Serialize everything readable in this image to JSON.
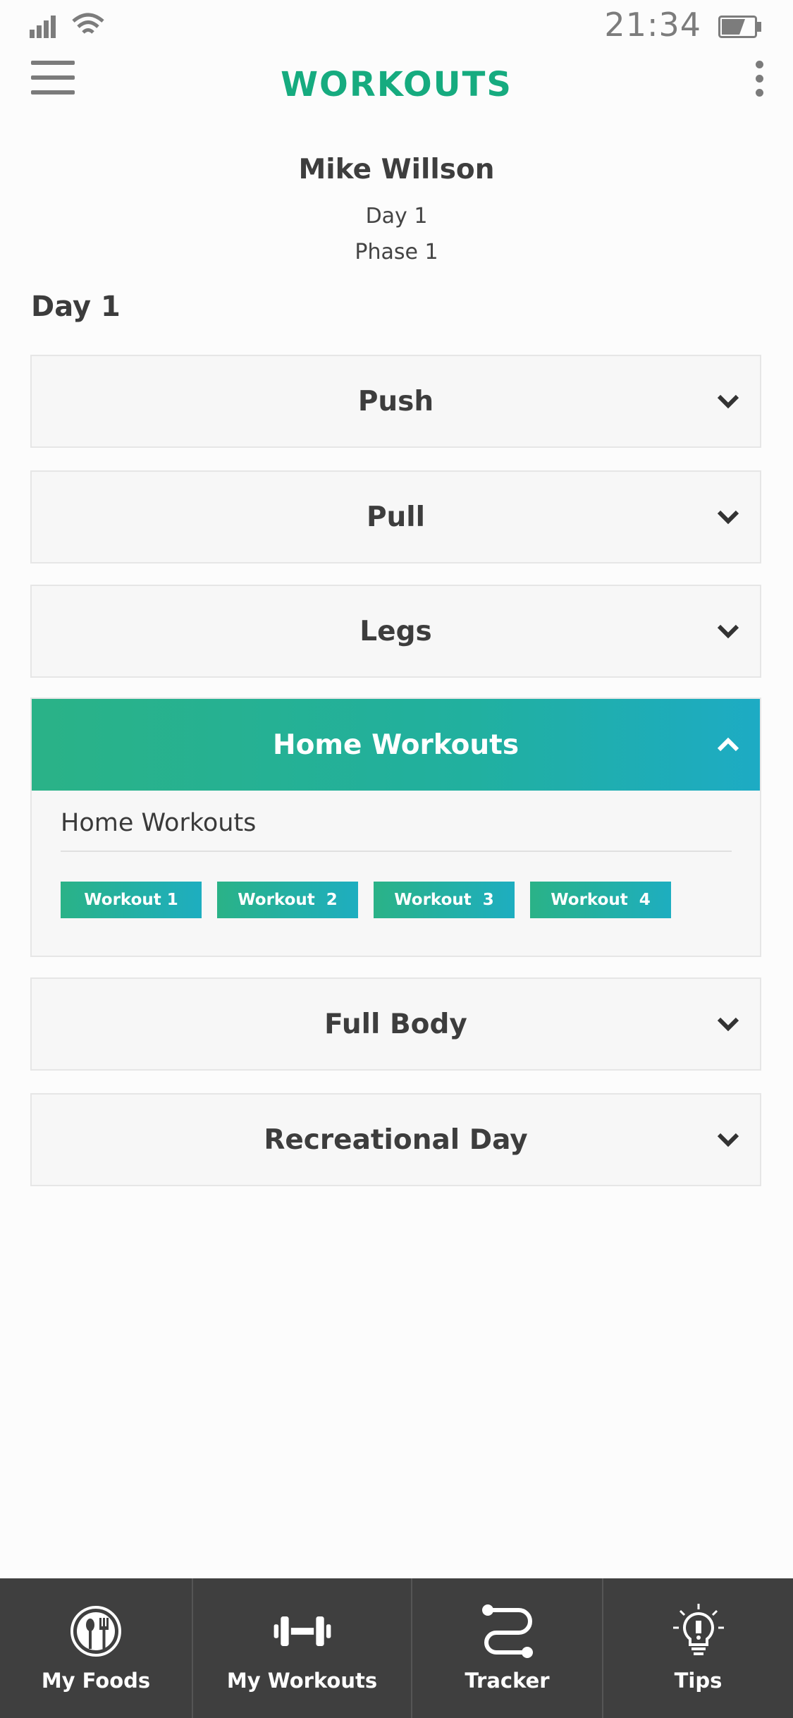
{
  "status_bar": {
    "time": "21:34"
  },
  "header": {
    "title": "WORKOUTS"
  },
  "profile": {
    "name": "Mike Willson",
    "day": "Day 1",
    "phase": "Phase 1"
  },
  "section_title": "Day 1",
  "categories": [
    {
      "label": "Push",
      "expanded": false
    },
    {
      "label": "Pull",
      "expanded": false
    },
    {
      "label": "Legs",
      "expanded": false
    },
    {
      "label": "Home Workouts",
      "expanded": true
    },
    {
      "label": "Full Body",
      "expanded": false
    },
    {
      "label": "Recreational Day",
      "expanded": false
    }
  ],
  "home_workouts": {
    "title": "Home Workouts",
    "buttons": [
      "Workout 1",
      "Workout  2",
      "Workout  3",
      "Workout  4"
    ]
  },
  "bottom_nav": [
    {
      "label": "My Foods",
      "icon": "foods-icon"
    },
    {
      "label": "My Workouts",
      "icon": "dumbbell-icon"
    },
    {
      "label": "Tracker",
      "icon": "tracker-icon"
    },
    {
      "label": "Tips",
      "icon": "lightbulb-icon"
    }
  ],
  "colors": {
    "accent": "#16ab7f",
    "gradient_start": "#2ab287",
    "gradient_end": "#1dabc4",
    "nav_background": "#3f3f3f"
  }
}
